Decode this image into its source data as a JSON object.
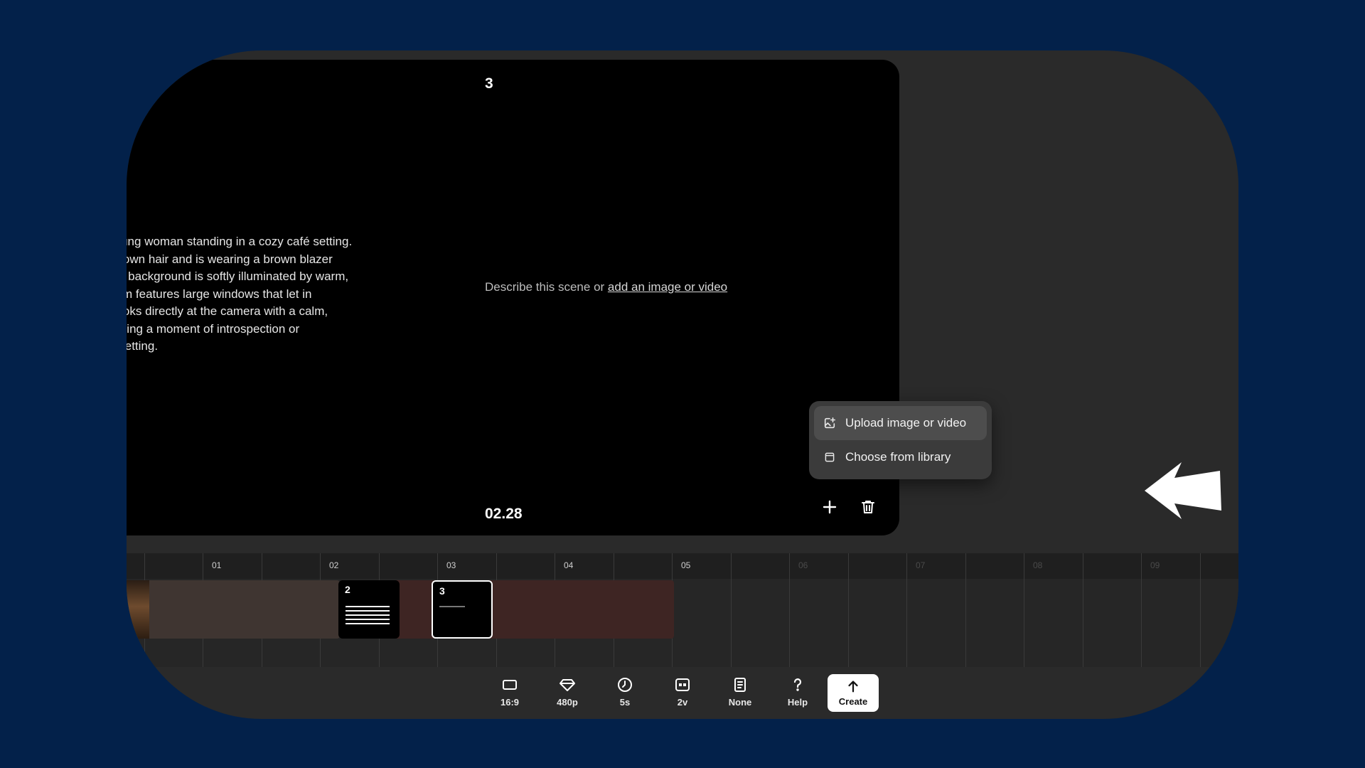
{
  "scene_left": {
    "description_lines": [
      "ers on a young woman standing in a cozy café setting.",
      "er-length brown hair and is wearing a brown blazer",
      "d scarf. The background is softly illuminated by warm,",
      " and the room features large windows that let in",
      "e woman looks directly at the camera with a calm,",
      "ession, offering a moment of introspection or",
      "is intimate setting."
    ],
    "actions": [
      "edit-icon",
      "trash-icon"
    ]
  },
  "scene_right": {
    "number": "3",
    "prompt_text": "Describe this scene or ",
    "prompt_link": "add an image or video",
    "time": "02.28",
    "actions": [
      "plus-icon",
      "trash-icon"
    ]
  },
  "popup": {
    "items": [
      {
        "label": "Upload image or video",
        "icon": "upload-media-icon",
        "highlighted": true
      },
      {
        "label": "Choose from library",
        "icon": "library-icon",
        "highlighted": false
      }
    ]
  },
  "timeline": {
    "ticks": [
      "01",
      "02",
      "03",
      "04",
      "05",
      "06",
      "07",
      "08",
      "09"
    ],
    "clips": [
      {
        "number": "2",
        "thumb": "text-lines"
      },
      {
        "number": "3",
        "thumb": "single-line"
      }
    ]
  },
  "toolbar": {
    "items": [
      {
        "label": "16:9",
        "icon": "aspect-ratio-icon"
      },
      {
        "label": "480p",
        "icon": "quality-diamond-icon"
      },
      {
        "label": "5s",
        "icon": "clock-icon"
      },
      {
        "label": "2v",
        "icon": "variations-icon"
      },
      {
        "label": "None",
        "icon": "preset-icon"
      },
      {
        "label": "Help",
        "icon": "help-icon"
      }
    ],
    "create_label": "Create"
  },
  "colors": {
    "page_bg": "#03214a",
    "frame_bg": "#2a2a2a",
    "card_bg": "#000000",
    "segment_a": "#3f3531",
    "segment_b": "#3e2523"
  }
}
